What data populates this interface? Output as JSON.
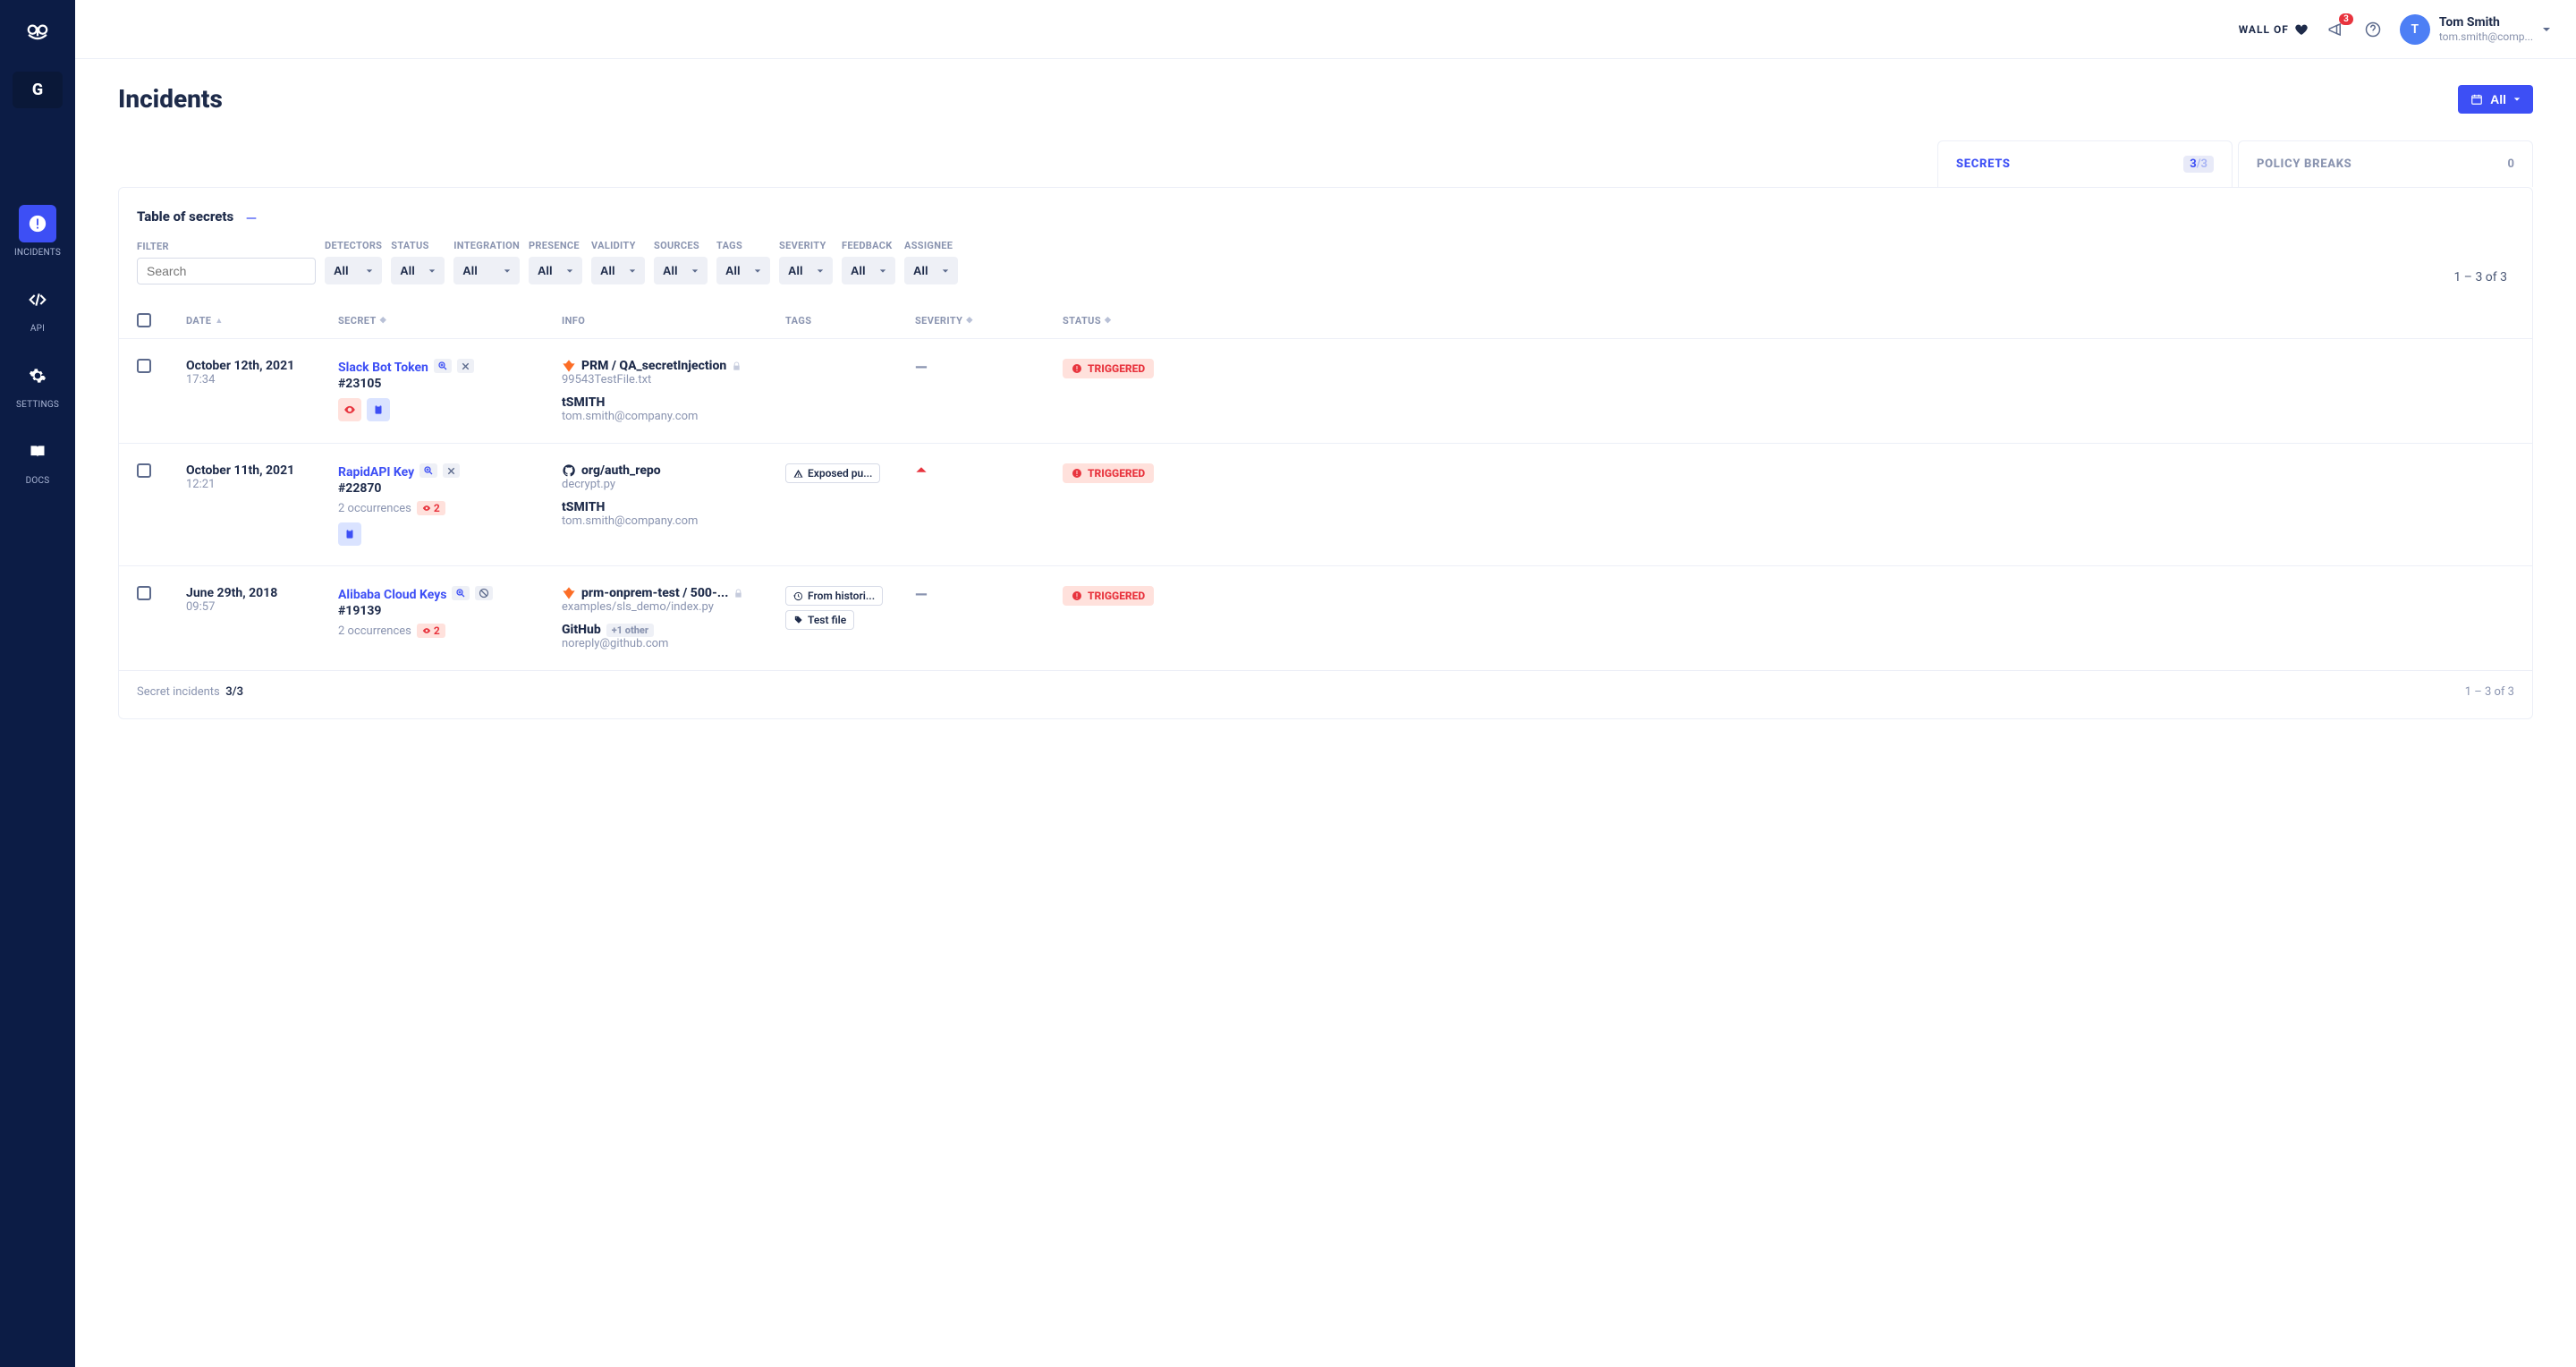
{
  "sidebar": {
    "workspace_letter": "G",
    "items": [
      {
        "label": "INCIDENTS"
      },
      {
        "label": "API"
      },
      {
        "label": "SETTINGS"
      },
      {
        "label": "DOCS"
      }
    ]
  },
  "topbar": {
    "wallof": "WALL OF",
    "notif_count": "3",
    "user_initial": "T",
    "user_name": "Tom Smith",
    "user_email": "tom.smith@comp..."
  },
  "page": {
    "title": "Incidents",
    "date_filter": "All"
  },
  "tabs": {
    "secrets": {
      "label": "SECRETS",
      "count": "3",
      "total": "/3"
    },
    "policy": {
      "label": "POLICY BREAKS",
      "count": "0"
    }
  },
  "card": {
    "title": "Table of secrets",
    "filter_label": "FILTER",
    "search_placeholder": "Search",
    "filters": {
      "detectors": {
        "label": "DETECTORS",
        "value": "All"
      },
      "status": {
        "label": "STATUS",
        "value": "All"
      },
      "integration": {
        "label": "INTEGRATION",
        "value": "All"
      },
      "presence": {
        "label": "PRESENCE",
        "value": "All"
      },
      "validity": {
        "label": "VALIDITY",
        "value": "All"
      },
      "sources": {
        "label": "SOURCES",
        "value": "All"
      },
      "tags": {
        "label": "TAGS",
        "value": "All"
      },
      "severity": {
        "label": "SEVERITY",
        "value": "All"
      },
      "feedback": {
        "label": "FEEDBACK",
        "value": "All"
      },
      "assignee": {
        "label": "ASSIGNEE",
        "value": "All"
      }
    },
    "pager": "1 – 3  of  3",
    "columns": {
      "date": "DATE",
      "secret": "SECRET",
      "info": "INFO",
      "tags": "TAGS",
      "severity": "SEVERITY",
      "status": "STATUS"
    }
  },
  "rows": [
    {
      "date": "October 12th, 2021",
      "time": "17:34",
      "secret_name": "Slack Bot Token",
      "secret_id": "#23105",
      "occurrences": "",
      "repo": "PRM / QA_secretInjection",
      "file": "99543TestFile.txt",
      "author": "tSMITH",
      "email": "tom.smith@company.com",
      "tags": [],
      "severity": "—",
      "status": "TRIGGERED",
      "provider": "gitlab",
      "has_x": true,
      "has_ban": false,
      "has_eye_badge": true,
      "has_clip_badge": true,
      "has_lock": true
    },
    {
      "date": "October 11th, 2021",
      "time": "12:21",
      "secret_name": "RapidAPI Key",
      "secret_id": "#22870",
      "occurrences": "2 occurrences",
      "occ_count": "2",
      "repo": "org/auth_repo",
      "file": "decrypt.py",
      "author": "tSMITH",
      "email": "tom.smith@company.com",
      "tags": [
        {
          "icon": "warn",
          "text": "Exposed pu..."
        }
      ],
      "severity": "up",
      "status": "TRIGGERED",
      "provider": "github",
      "has_x": true,
      "has_ban": false,
      "has_eye_badge": false,
      "has_clip_badge": true,
      "has_lock": false
    },
    {
      "date": "June 29th, 2018",
      "time": "09:57",
      "secret_name": "Alibaba Cloud Keys",
      "secret_id": "#19139",
      "occurrences": "2 occurrences",
      "occ_count": "2",
      "repo": "prm-onprem-test / 500-...",
      "file": "examples/sls_demo/index.py",
      "author": "GitHub",
      "author_extra": "+1 other",
      "email": "noreply@github.com",
      "tags": [
        {
          "icon": "history",
          "text": "From histori..."
        },
        {
          "icon": "tag",
          "text": "Test file"
        }
      ],
      "severity": "—",
      "status": "TRIGGERED",
      "provider": "gitlab",
      "has_x": false,
      "has_ban": true,
      "has_eye_badge": false,
      "has_clip_badge": false,
      "has_lock": true
    }
  ],
  "footer": {
    "left_label": "Secret incidents",
    "left_count": "3/3",
    "right": "1 – 3  of  3"
  }
}
